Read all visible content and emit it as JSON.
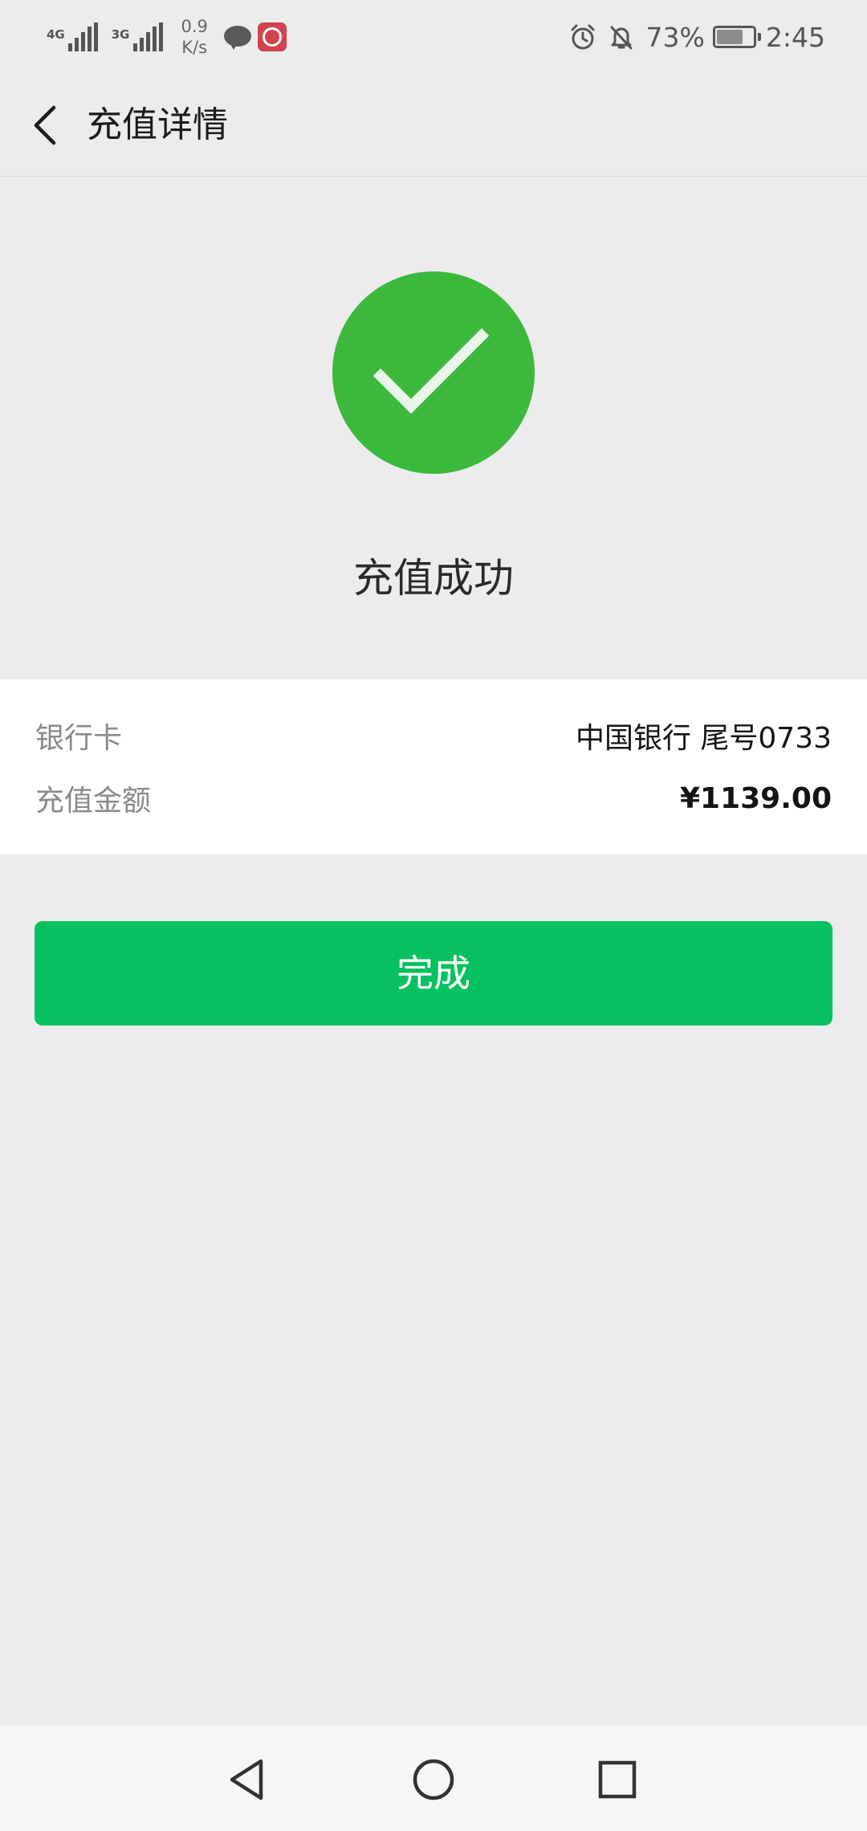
{
  "status_bar": {
    "network_1": "4G",
    "network_2": "3G",
    "speed_value": "0.9",
    "speed_unit": "K/s",
    "battery_percent": "73%",
    "battery_level": 0.73,
    "time": "2:45",
    "icons": [
      "signal-icon",
      "chat-bubble-icon",
      "bank-of-china-icon",
      "alarm-icon",
      "bell-off-icon",
      "battery-icon"
    ]
  },
  "header": {
    "title": "充值详情",
    "back_icon": "chevron-left-icon"
  },
  "result": {
    "title": "充值成功",
    "icon": "check-circle-icon",
    "icon_color": "#3cb93c"
  },
  "details": {
    "rows": [
      {
        "label": "银行卡",
        "value": "中国银行 尾号0733"
      },
      {
        "label": "充值金额",
        "value": "¥1139.00"
      }
    ]
  },
  "actions": {
    "done_label": "完成",
    "done_color": "#07c160"
  },
  "system_nav": {
    "buttons": [
      "back-triangle-icon",
      "home-circle-icon",
      "recent-square-icon"
    ]
  }
}
